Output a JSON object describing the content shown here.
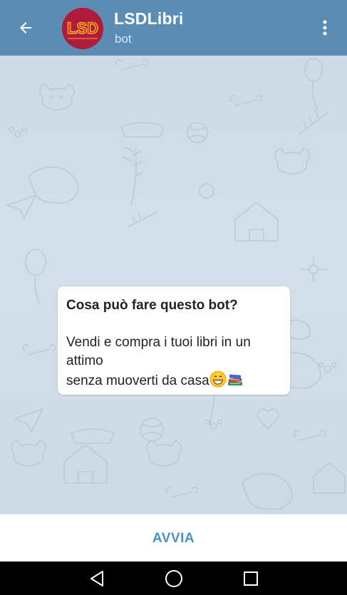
{
  "header": {
    "title": "LSDLibri",
    "subtitle": "bot",
    "avatar_text": "LSD"
  },
  "message": {
    "title": "Cosa può fare questo bot?",
    "line1": "Vendi e compra i tuoi libri in un",
    "line2": "attimo",
    "line3": "senza muoverti da casa"
  },
  "bottom_bar": {
    "start_label": "AVVIA"
  },
  "colors": {
    "header": "#5b8db4",
    "accent": "#4a93c8",
    "avatar": "#b01a3b"
  },
  "icons": [
    "back-arrow-icon",
    "more-vertical-icon",
    "grinning-face-icon",
    "books-icon",
    "nav-back-icon",
    "nav-home-icon",
    "nav-recents-icon"
  ]
}
